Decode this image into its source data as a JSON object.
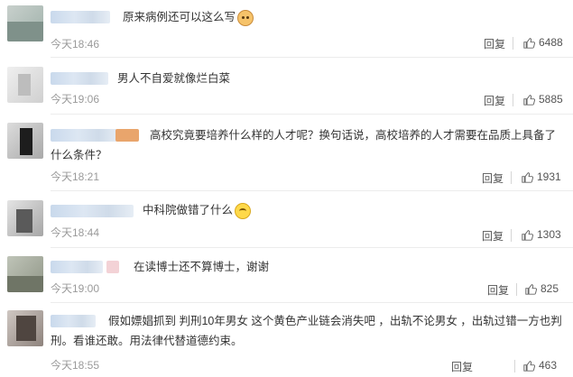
{
  "reply_label": "回复",
  "comments": [
    {
      "text": "原来病例还可以这么写",
      "time": "今天18:46",
      "likes": "6488",
      "emoji": "cat-icon"
    },
    {
      "text": "男人不自爱就像烂白菜",
      "time": "今天19:06",
      "likes": "5885"
    },
    {
      "text": "高校究竟要培养什么样的人才呢？换句话说，高校培养的人才需要在品质上具备了什么条件？",
      "time": "今天18:21",
      "likes": "1931"
    },
    {
      "text": "中科院做错了什么",
      "time": "今天18:44",
      "likes": "1303",
      "emoji": "worried-face-icon"
    },
    {
      "text": "在读博士还不算博士，谢谢",
      "time": "今天19:00",
      "likes": "825"
    },
    {
      "text": "假如嫖娼抓到 判刑10年男女 这个黄色产业链会消失吧 ，出轨不论男女 ，出轨过错一方也判刑。看谁还敢。用法律代替道德约束。",
      "time": "今天18:55",
      "likes": "463"
    }
  ],
  "colors": {
    "text": "#333333",
    "meta": "#9a9a9a",
    "divider": "#ececec"
  }
}
